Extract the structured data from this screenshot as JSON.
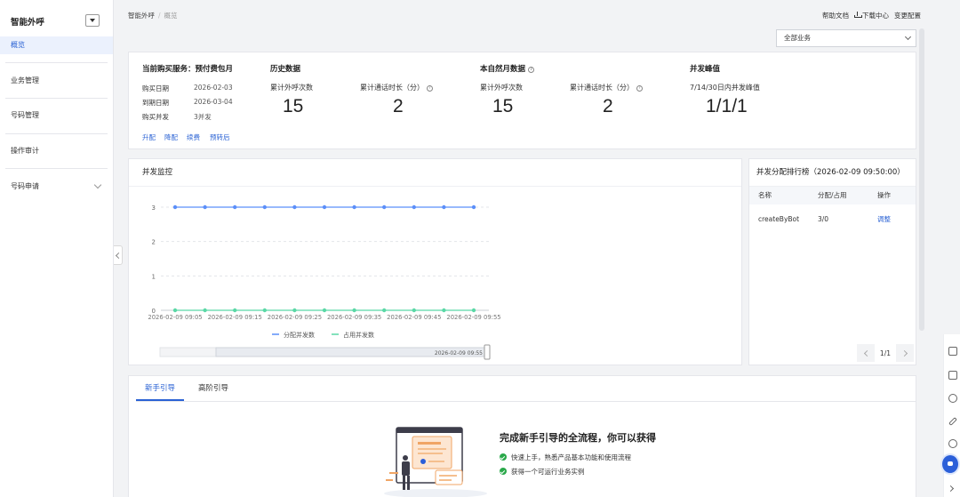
{
  "sidebar": {
    "title": "智能外呼",
    "items": [
      {
        "label": "概览",
        "active": true
      },
      {
        "label": "业务管理"
      },
      {
        "label": "号码管理"
      },
      {
        "label": "操作审计"
      },
      {
        "label": "号码申请"
      }
    ]
  },
  "breadcrumb": {
    "root": "智能外呼",
    "separator": "/",
    "current": "概览"
  },
  "top_links": {
    "help": "帮助文档",
    "download": "下载中心",
    "config": "变更配置"
  },
  "business_select": {
    "value": "全部业务"
  },
  "service": {
    "title": "当前购买服务：预付费包月",
    "rows": [
      {
        "label": "购买日期",
        "value": "2026-02-03"
      },
      {
        "label": "到期日期",
        "value": "2026-03-04"
      },
      {
        "label": "购买并发",
        "value": "3并发"
      }
    ],
    "actions": [
      "升配",
      "降配",
      "续费",
      "预转后"
    ]
  },
  "history": {
    "title": "历史数据",
    "calls_label": "累计外呼次数",
    "calls_value": "15",
    "duration_label": "累计通话时长（分）",
    "duration_value": "2"
  },
  "month": {
    "title": "本自然月数据",
    "calls_label": "累计外呼次数",
    "calls_value": "15",
    "duration_label": "累计通话时长（分）",
    "duration_value": "2"
  },
  "peak": {
    "title": "并发峰值",
    "label": "7/14/30日内并发峰值",
    "value": "1/1/1"
  },
  "monitor": {
    "title": "并发监控",
    "slider_label": "2026-02-09 09:55"
  },
  "chart_data": {
    "type": "line",
    "x_ticks": [
      "2026-02-09 09:05",
      "2026-02-09 09:15",
      "2026-02-09 09:25",
      "2026-02-09 09:35",
      "2026-02-09 09:45",
      "2026-02-09 09:55"
    ],
    "point_count": 11,
    "ylim": [
      0,
      3
    ],
    "y_ticks": [
      "0",
      "1",
      "2",
      "3"
    ],
    "grid": true,
    "legend_position": "bottom",
    "series": [
      {
        "name": "分配并发数",
        "color": "#5b8ff9",
        "values": [
          3,
          3,
          3,
          3,
          3,
          3,
          3,
          3,
          3,
          3,
          3
        ]
      },
      {
        "name": "占用并发数",
        "color": "#5ad8a6",
        "values": [
          0,
          0,
          0,
          0,
          0,
          0,
          0,
          0,
          0,
          0,
          0
        ]
      }
    ]
  },
  "ranking": {
    "title": "并发分配排行榜（2026-02-09 09:50:00）",
    "headers": {
      "name": "名称",
      "alloc": "分配/占用",
      "op": "操作"
    },
    "rows": [
      {
        "name": "createByBot",
        "alloc": "3/0",
        "op": "调整"
      }
    ],
    "page": "1/1"
  },
  "guide": {
    "tabs": [
      {
        "label": "新手引导",
        "active": true
      },
      {
        "label": "高阶引导"
      }
    ],
    "title": "完成新手引导的全流程，你可以获得",
    "items": [
      "快速上手，熟悉产品基本功能和使用流程",
      "获得一个可运行业务实例"
    ]
  },
  "colors": {
    "accent": "#2a62d4",
    "success": "#2aa84a"
  }
}
